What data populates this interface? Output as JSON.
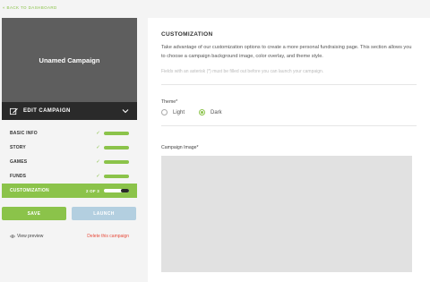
{
  "nav": {
    "back_label": "« BACK TO DASHBOARD"
  },
  "campaign": {
    "name": "Unamed Campaign"
  },
  "edit_bar": {
    "label": "EDIT CAMPAIGN"
  },
  "steps": [
    {
      "label": "BASIC INFO",
      "complete": true
    },
    {
      "label": "STORY",
      "complete": true
    },
    {
      "label": "GAMES",
      "complete": true
    },
    {
      "label": "FUNDS",
      "complete": true
    }
  ],
  "active_step": {
    "label": "CUSTOMIZATION",
    "count": "2 OF 3",
    "progress": 0.67
  },
  "buttons": {
    "save": "SAVE",
    "launch": "LAUNCH"
  },
  "links": {
    "preview": "View preview",
    "delete": "Delete this campaign"
  },
  "panel": {
    "title": "CUSTOMIZATION",
    "description": "Take advantage of our customization options to create a more personal fundraising page. This section allows you to choose a campaign background image, color overlay, and theme style.",
    "note": "Fields with an asterisk (*) must be filled out before you can launch your campaign.",
    "theme_label": "Theme*",
    "theme_options": [
      {
        "label": "Light",
        "selected": false
      },
      {
        "label": "Dark",
        "selected": true
      }
    ],
    "image_label": "Campaign Image*"
  },
  "colors": {
    "accent": "#8bc34a",
    "dark": "#2a2a2a",
    "launch": "#b3cfe0",
    "danger": "#e74c3c",
    "hero_bg": "#5e5e5e"
  }
}
